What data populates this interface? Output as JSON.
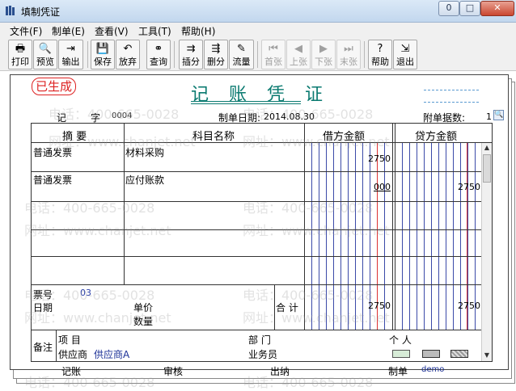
{
  "window": {
    "title": "填制凭证",
    "min_glyph": "0",
    "max_glyph": "□",
    "close_glyph": "✕"
  },
  "menu": [
    "文件(F)",
    "制单(E)",
    "查看(V)",
    "工具(T)",
    "帮助(H)"
  ],
  "toolbar": {
    "print": "打印",
    "preview": "预览",
    "export": "输出",
    "save": "保存",
    "discard": "放弃",
    "query": "查询",
    "insert": "插分",
    "delete": "删分",
    "flow": "流量",
    "first": "首张",
    "prev": "上张",
    "next": "下张",
    "last": "末张",
    "help": "帮助",
    "exit": "退出"
  },
  "voucher": {
    "status": "已生成",
    "title": "记 账 凭 证",
    "type_label": "记",
    "no_label": "字",
    "number": "0004",
    "date_label": "制单日期:",
    "date": "2014.08.30",
    "attach_label": "附单据数:",
    "attach_count": "1"
  },
  "grid": {
    "headers": {
      "summary": "摘 要",
      "account": "科目名称",
      "debit": "借方金额",
      "credit": "贷方金额"
    },
    "rows": [
      {
        "summary": "普通发票",
        "account": "材料采购",
        "debit": "2750",
        "credit": ""
      },
      {
        "summary": "普通发票",
        "account": "应付账款",
        "debit": "000",
        "credit": "2750"
      }
    ],
    "ticket_label": "票号",
    "ticket_value": "03",
    "date_label": "日期",
    "unit_price_label": "单价",
    "quantity_label": "数量",
    "total_label": "合 计",
    "total_debit": "2750",
    "total_credit": "2750",
    "notes_label": "备注",
    "project_label": "项  目",
    "dept_label": "部  门",
    "person_label": "个  人",
    "supplier_label": "供应商",
    "supplier_value": "供应商A",
    "salesman_label": "业务员"
  },
  "footer": {
    "bookkeeper": "记账",
    "auditor": "审核",
    "cashier": "出纳",
    "maker_label": "制单",
    "maker": "demo"
  },
  "watermarks": [
    "电话：400-665-0028",
    "网址：www.chanjet.net"
  ]
}
